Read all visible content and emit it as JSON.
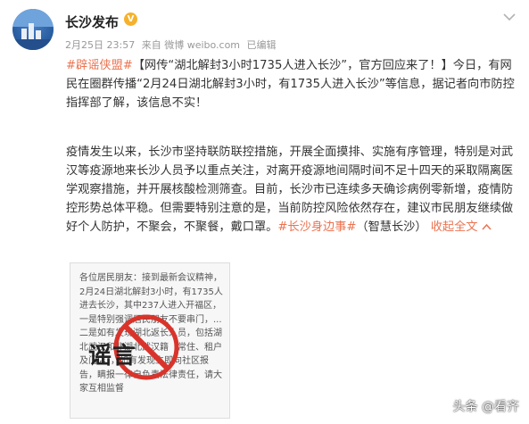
{
  "post": {
    "username": "长沙发布",
    "verified_badge": "V",
    "date": "2月25日 23:57",
    "source": "来自 微博 weibo.com",
    "edited": "已编辑",
    "icons": {
      "verified": "verified-v-icon",
      "menu": "chevron-down-icon"
    }
  },
  "content": {
    "p1_tag": "#辟谣侠盟#",
    "p1_text": "【网传“湖北解封3小时1735人进入长沙”，官方回应来了！】今日，有网民在圈群传播“2月24日湖北解封3小时，有1735人进入长沙”等信息，据记者向市防控指挥部了解，该信息不实！",
    "p2_text": "疫情发生以来，长沙市坚持联防联控措施，开展全面摸排、实施有序管理，特别是对武汉等疫源地来长沙人员予以重点关注，对离开疫源地间隔时间不足十四天的采取隔离医学观察措施，并开展核酸检测筛查。目前，长沙市已连续多天确诊病例零新增，疫情防控形势总体平稳。但需要特别注意的是，当前防控风险依然存在，建议市民朋友继续做好个人防护，不聚会，不聚餐，戴口罩。",
    "p2_tag": "#长沙身边事#",
    "p2_mention": "（智慧长沙）",
    "collapse_label": "收起全文",
    "collapse_icon": "chevron-up-icon"
  },
  "image": {
    "notice_text": "各位居民朋友：接到最新会议精神，2月24日湖北解封3小时，有1735人进去长沙，其中237人进入开福区，一是特别强调居民朋友不要串门，... 二是如有发现湖北返长人员，包括湖北武汉和非湖北武汉籍（常住、租户及门店），如有发现立即向社区报告，瞒报一律自负责法律责任，请大家互相监督",
    "stamp_text": "谣言",
    "stamp_color": "#d9342b"
  },
  "watermark": "头条 @看齐"
}
